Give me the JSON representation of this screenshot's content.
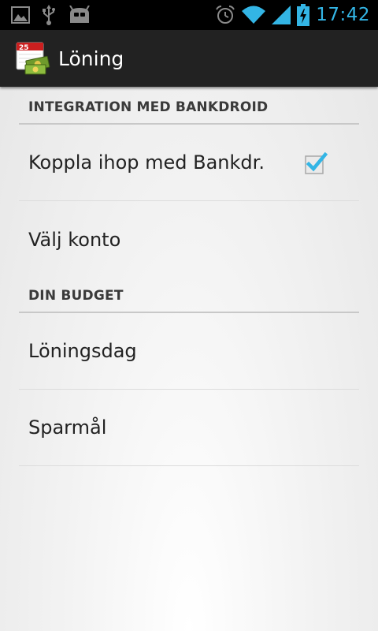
{
  "status_bar": {
    "time": "17:42",
    "left_icons": [
      "image-icon",
      "usb-icon",
      "cyanogenmod-icon"
    ],
    "right_icons": [
      "alarm-icon",
      "wifi-icon",
      "signal-icon",
      "battery-charging-icon"
    ],
    "accent_color": "#33b5e5"
  },
  "action_bar": {
    "title": "Löning",
    "icon_day": "25"
  },
  "sections": [
    {
      "header": "INTEGRATION MED BANKDROID",
      "items": [
        {
          "label": "Koppla ihop med Bankdr.",
          "checked": true
        },
        {
          "label": "Välj konto"
        }
      ]
    },
    {
      "header": "DIN BUDGET",
      "items": [
        {
          "label": "Löningsdag"
        },
        {
          "label": "Sparmål"
        }
      ]
    }
  ]
}
